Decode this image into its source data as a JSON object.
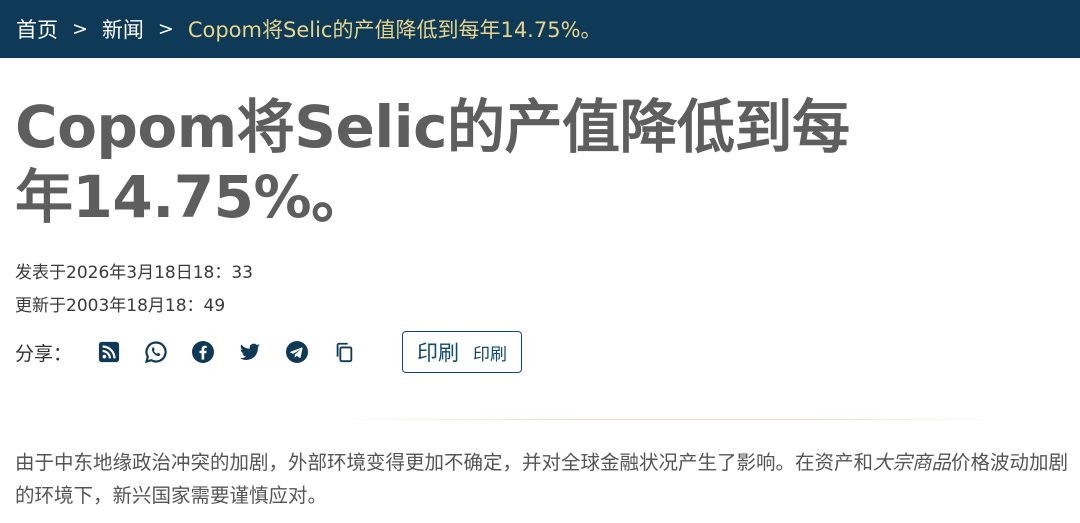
{
  "breadcrumb": {
    "home": "首页",
    "separator": ">",
    "news": "新闻",
    "current": "Copom将Selic的产值降低到每年14.75%。"
  },
  "article": {
    "title": "Copom将Selic的产值降低到每年14.75%。",
    "published": "发表于2026年3月18日18：33",
    "updated": "更新于2003年18月18：49",
    "body_part1": "由于中东地缘政治冲突的加剧，外部环境变得更加不确定，并对全球金融状况产生了影响。在资产和",
    "body_italic": "大宗商品",
    "body_part2": "价格波动加剧的环境下，新兴国家需要谨慎应对。"
  },
  "share": {
    "label": "分享：",
    "icons": [
      "rss-icon",
      "whatsapp-icon",
      "facebook-icon",
      "twitter-icon",
      "telegram-icon",
      "copy-icon"
    ],
    "print_label_large": "印刷",
    "print_label_small": "印刷"
  },
  "colors": {
    "header_bg": "#0e3a57",
    "breadcrumb_current": "#e7d38c",
    "icon_color": "#0e3a57",
    "title_color": "#5e5e5e"
  }
}
